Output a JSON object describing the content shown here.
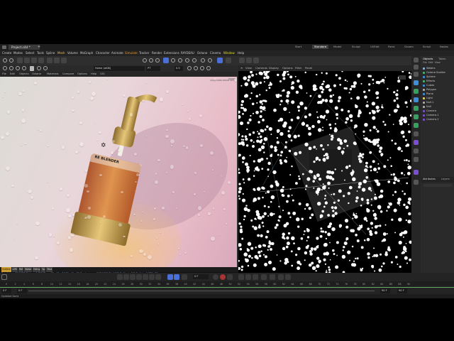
{
  "window": {
    "doc_tab": "Project.c4d *",
    "layout_tabs": [
      "Start",
      "Standard",
      "Model",
      "Sculpt",
      "UVEdit",
      "Paint",
      "Groom",
      "Script",
      "Nodes"
    ]
  },
  "menu": [
    "Create",
    "Modes",
    "Select",
    "Tools",
    "Spline",
    "Mesh",
    "Volume",
    "MoGraph",
    "Character",
    "Animate",
    "Simulate",
    "Tracker",
    "Render",
    "Extensions",
    "RAYDEAU",
    "Octane",
    "Window",
    "Help"
  ],
  "viewport_left": {
    "menu": [
      "View",
      "Cameras",
      "Display",
      "Options",
      "Filter",
      "Panel"
    ],
    "render_menu": [
      "File",
      "Edit",
      "Objects",
      "Octane",
      "Materials",
      "Compare",
      "Options",
      "Help"
    ],
    "camera_field": "Home (ot08)",
    "brand_text": "RE BLENDER",
    "status_chips": [
      "Outline",
      "LMS",
      "Ref",
      "Noise",
      "Hdrsy",
      "Sp",
      "Post"
    ],
    "status_line": "Rendering: 31/1476   Ms/sec: 1.795   Time: 00 : 00 : 56/00 : 11 : 30   Spp/maxspp: 292/1000   Tri: 0/17.6k   Mesh: 2/8.0k   Hair: 0   GPU: 70"
  },
  "viewport_right": {
    "menu": [
      "View",
      "Cameras",
      "Display",
      "Options",
      "Filter",
      "Panel"
    ]
  },
  "objects_panel": {
    "tabs": [
      "Objects",
      "Takes"
    ],
    "menu": [
      "File",
      "Edit",
      "View"
    ],
    "items": [
      "Waters",
      "Octane Scatter",
      "Sphere",
      "Effects",
      "Cubes",
      "Polygon",
      "Plane",
      "Light",
      "Null.1",
      "Null",
      "Camera",
      "Camera.1",
      "Camera.2"
    ],
    "attributes_tabs": [
      "Attributes",
      "Layers"
    ]
  },
  "timeline": {
    "current_frame": "0 F",
    "frame_field": "0 F",
    "start_left": "0 F",
    "start_left2": "0 F",
    "end_right": "90 F",
    "end_right2": "90 F",
    "ticks": [
      "0",
      "2",
      "4",
      "6",
      "8",
      "10",
      "12",
      "14",
      "16",
      "18",
      "20",
      "22",
      "24",
      "26",
      "28",
      "30",
      "32",
      "34",
      "36",
      "38",
      "40",
      "42",
      "44",
      "46",
      "48",
      "50",
      "52",
      "54",
      "56",
      "58",
      "60",
      "62",
      "64",
      "66",
      "68",
      "70",
      "72",
      "74",
      "76",
      "78",
      "80",
      "82",
      "84",
      "86",
      "88",
      "90"
    ]
  },
  "footer": {
    "status": "Updated Done"
  },
  "colors": {
    "accent": "#4a6fd8",
    "menu_highlight_mesh": "#f0c040",
    "menu_highlight_simulate": "#e89a2c",
    "menu_highlight_window": "#e0e030",
    "bottle_amber": "#d47a2a",
    "gold": "#c9a046"
  }
}
